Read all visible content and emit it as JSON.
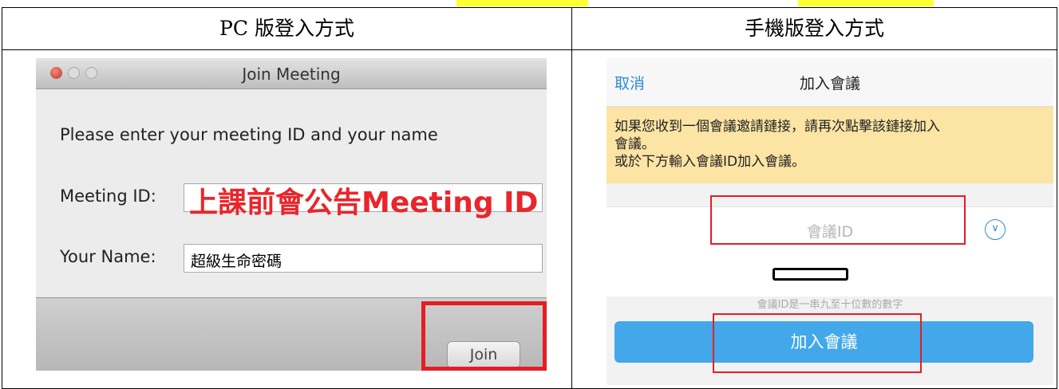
{
  "table": {
    "headers": [
      "PC 版登入方式",
      "手機版登入方式"
    ]
  },
  "pc": {
    "window_title": "Join Meeting",
    "prompt": "Please enter your meeting ID and your name",
    "meeting_id_label": "Meeting ID:",
    "meeting_id_value": "上課前會公告Meeting ID",
    "name_label": "Your Name:",
    "name_value": "超級生命密碼",
    "join_label": "Join"
  },
  "mobile": {
    "cancel_label": "取消",
    "title": "加入會議",
    "notice_lines": [
      "如果您收到一個會議邀請鏈接，請再次點擊該鏈接加入",
      "會議。",
      "或於下方輸入會議ID加入會議。"
    ],
    "meeting_id_placeholder": "會議ID",
    "hint": "會議ID是一串九至十位數的數字",
    "join_label": "加入會議"
  },
  "colors": {
    "highlight": "#ffff33",
    "annotation_red": "#e31e24",
    "mobile_accent": "#2d8bd9",
    "mobile_join": "#42a8ea",
    "notice_bg": "#fbe4a4"
  }
}
